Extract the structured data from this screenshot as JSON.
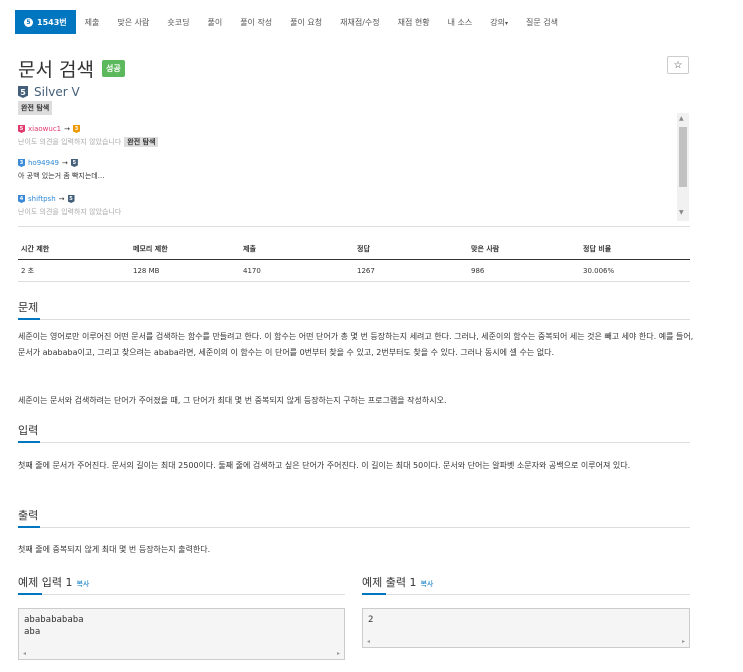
{
  "nav": {
    "active_label": "1543번",
    "active_icon": "number-circle-icon",
    "items": [
      "제출",
      "맞은 사람",
      "숏코딩",
      "풀이",
      "풀이 작성",
      "풀이 요청",
      "재채점/수정",
      "채점 현황",
      "내 소스",
      "강의",
      "질문 검색"
    ],
    "dropdown_caret": "▾"
  },
  "problem": {
    "title": "문서 검색",
    "result_badge": "성공",
    "star": "☆",
    "tier_level": "5",
    "tier_name": "Silver V",
    "tag": "완전 탐색"
  },
  "comments": [
    {
      "user": "xiaowuc1",
      "arrow": "→",
      "level_from": "5",
      "level_to": "3",
      "text": "난이도 의견을 입력하지 않았습니다",
      "tag": "완전 탐색"
    },
    {
      "user": "ho94949",
      "arrow": "→",
      "level_from": "3",
      "level_to": "5",
      "text": "아 공백 있는거 좀 빡지는데..."
    },
    {
      "user": "shiftpsh",
      "arrow": "→",
      "level_from": "4",
      "level_to": "5",
      "text": "난이도 의견을 입력하지 않았습니다"
    }
  ],
  "stats": {
    "headers": [
      "시간 제한",
      "메모리 제한",
      "제출",
      "정답",
      "맞은 사람",
      "정답 비율"
    ],
    "values": [
      "2 초",
      "128 MB",
      "4170",
      "1267",
      "986",
      "30.006%"
    ]
  },
  "sections": {
    "problem_title": "문제",
    "problem_p1": "세준이는 영어로만 이루어진 어떤 문서를 검색하는 함수를 만들려고 한다. 이 함수는 어떤 단어가 총 몇 번 등장하는지 세려고 한다. 그러나, 세준이의 함수는 중복되어 세는 것은 빼고 세야 한다. 예를 들어, 문서가 abababa이고, 그리고 찾으려는 ababa라면, 세준이의 이 함수는 이 단어를 0번부터 찾을 수 있고, 2번부터도 찾을 수 있다. 그러나 동시에 셀 수는 없다.",
    "problem_p2": "세준이는 문서와 검색하려는 단어가 주어졌을 때, 그 단어가 최대 몇 번 중복되지 않게 등장하는지 구하는 프로그램을 작성하시오.",
    "input_title": "입력",
    "input_text": "첫째 줄에 문서가 주어진다. 문서의 길이는 최대 2500이다. 둘째 줄에 검색하고 싶은 단어가 주어진다. 이 길이는 최대 50이다. 문서와 단어는 알파벳 소문자와 공백으로 이루어져 있다.",
    "output_title": "출력",
    "output_text": "첫째 줄에 중복되지 않게 최대 몇 번 등장하는지 출력한다."
  },
  "samples": {
    "input_title": "예제 입력 1",
    "output_title": "예제 출력 1",
    "copy_label": "복사",
    "input_text": "abababababa\naba",
    "output_text": "2",
    "scroll_left": "◂",
    "scroll_right": "▸"
  }
}
